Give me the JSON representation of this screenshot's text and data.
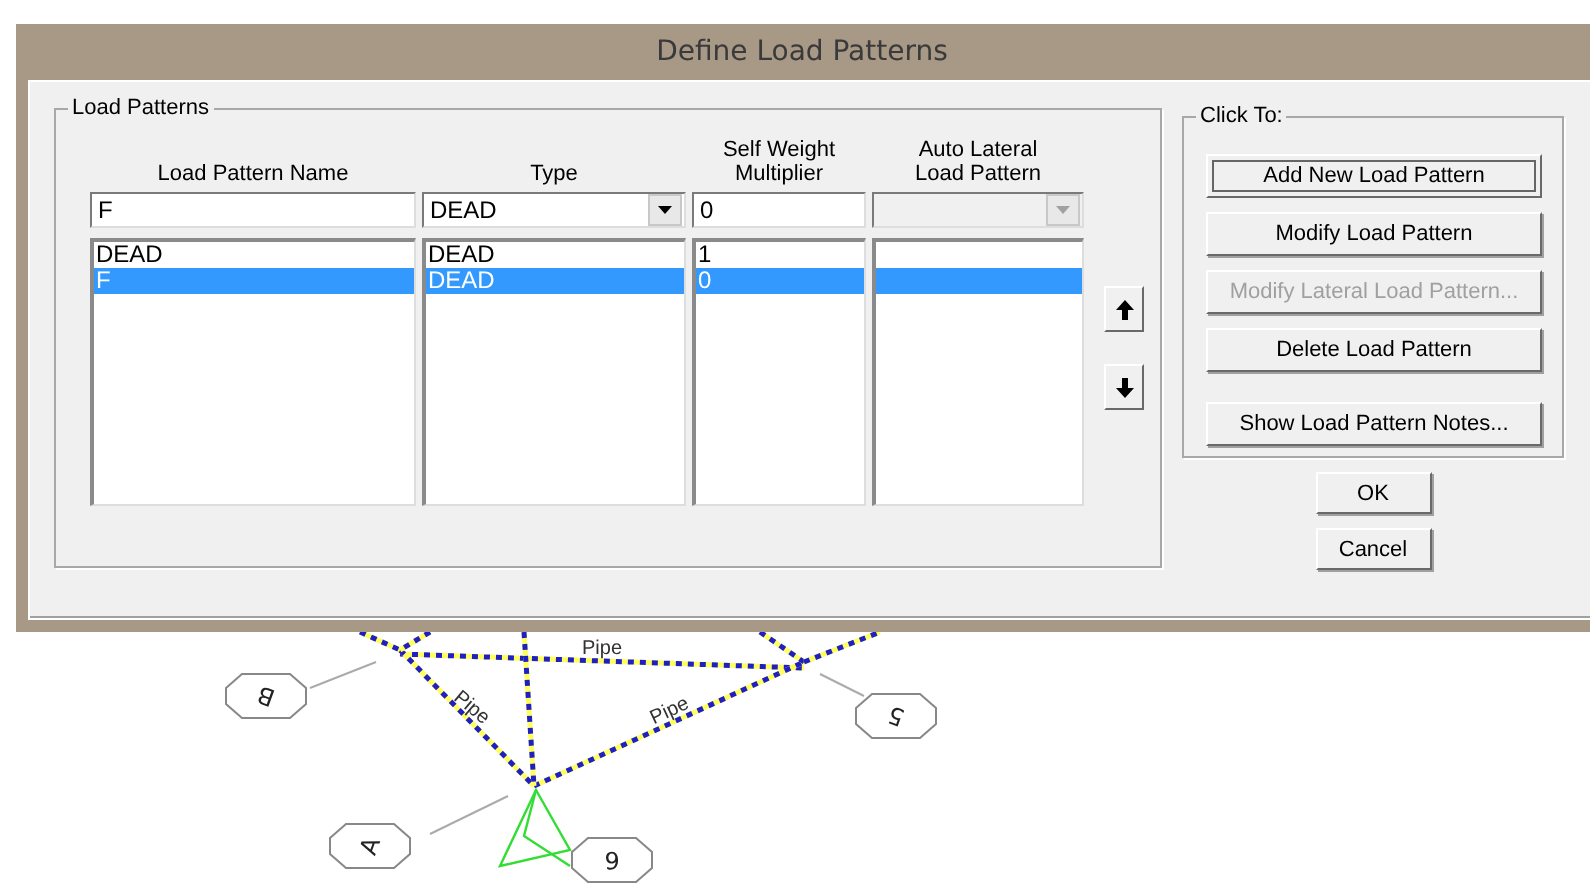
{
  "window": {
    "title": "Define Load Patterns"
  },
  "load_patterns": {
    "legend": "Load Patterns",
    "headers": [
      "Load Pattern Name",
      "Type",
      "Self Weight\nMultiplier",
      "Auto Lateral\nLoad Pattern"
    ],
    "entry": {
      "name": "F",
      "type": "DEAD",
      "multiplier": "0",
      "auto_lateral_disabled": true
    },
    "rows": [
      {
        "name": "DEAD",
        "type": "DEAD",
        "multiplier": "1",
        "selected": false
      },
      {
        "name": "F",
        "type": "DEAD",
        "multiplier": "0",
        "selected": true
      }
    ]
  },
  "click_to": {
    "legend": "Click To:",
    "buttons": [
      {
        "label": "Add New Load Pattern",
        "disabled": false,
        "focused": true
      },
      {
        "label": "Modify Load Pattern",
        "disabled": false,
        "focused": false
      },
      {
        "label": "Modify Lateral Load Pattern...",
        "disabled": true,
        "focused": false
      },
      {
        "label": "Delete Load Pattern",
        "disabled": false,
        "focused": false
      },
      {
        "label": "Show Load Pattern Notes...",
        "disabled": false,
        "focused": false
      }
    ]
  },
  "dialog_buttons": [
    "OK",
    "Cancel"
  ],
  "drawing": {
    "pipe_labels": [
      "Pipe",
      "Pipe",
      "Pipe"
    ],
    "grid_bubbles": [
      "B",
      "5",
      "A",
      "6"
    ]
  }
}
